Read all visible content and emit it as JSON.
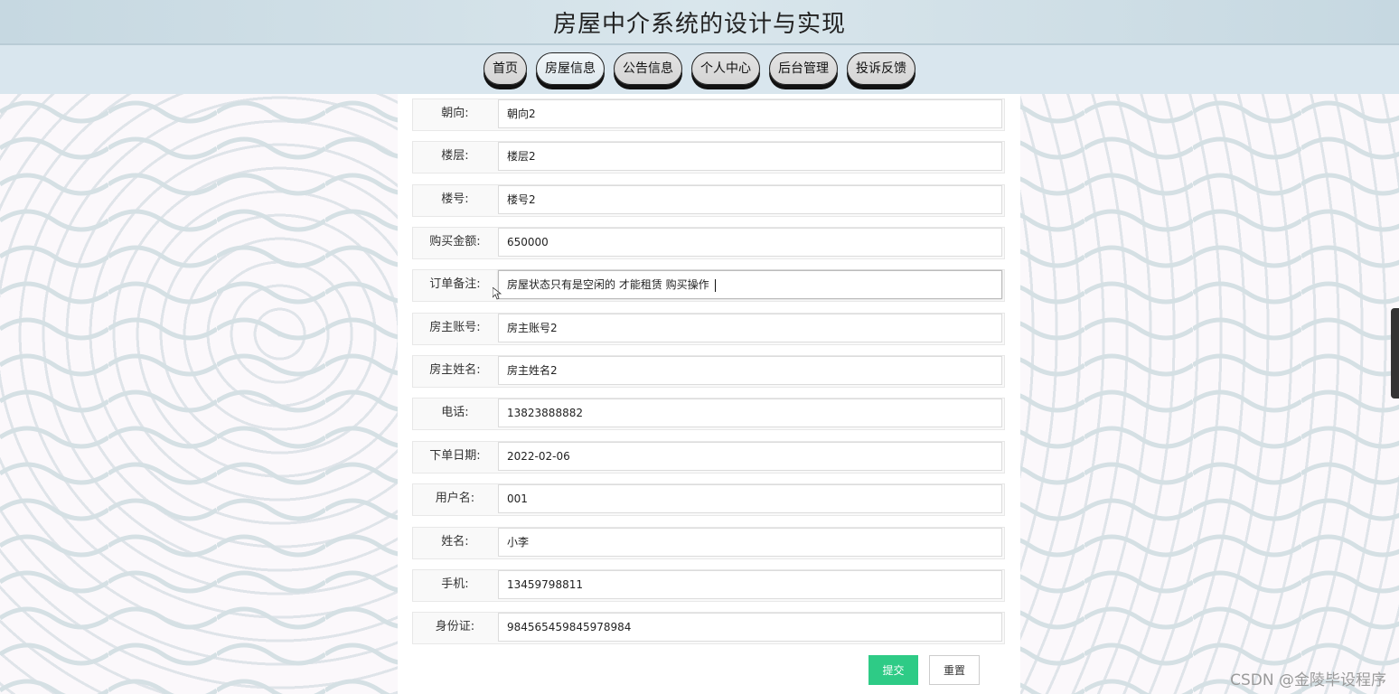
{
  "header": {
    "title": "房屋中介系统的设计与实现"
  },
  "nav": {
    "items": [
      {
        "label": "首页"
      },
      {
        "label": "房屋信息"
      },
      {
        "label": "公告信息"
      },
      {
        "label": "个人中心"
      },
      {
        "label": "后台管理"
      },
      {
        "label": "投诉反馈"
      }
    ]
  },
  "form": {
    "fields": [
      {
        "label": "朝向:",
        "value": "朝向2"
      },
      {
        "label": "楼层:",
        "value": "楼层2"
      },
      {
        "label": "楼号:",
        "value": "楼号2"
      },
      {
        "label": "购买金额:",
        "value": "650000"
      },
      {
        "label": "订单备注:",
        "value": "房屋状态只有是空闲的 才能租赁 购买操作"
      },
      {
        "label": "房主账号:",
        "value": "房主账号2"
      },
      {
        "label": "房主姓名:",
        "value": "房主姓名2"
      },
      {
        "label": "电话:",
        "value": "13823888882"
      },
      {
        "label": "下单日期:",
        "value": "2022-02-06"
      },
      {
        "label": "用户名:",
        "value": "001"
      },
      {
        "label": "姓名:",
        "value": "小李"
      },
      {
        "label": "手机:",
        "value": "13459798811"
      },
      {
        "label": "身份证:",
        "value": "984565459845978984"
      }
    ],
    "submit_label": "提交",
    "reset_label": "重置"
  },
  "watermark": "CSDN @金陵毕设程序",
  "colors": {
    "submit": "#2ecb86",
    "header_bg": "#c6d8e1",
    "nav_bg": "#d9e6ee"
  }
}
